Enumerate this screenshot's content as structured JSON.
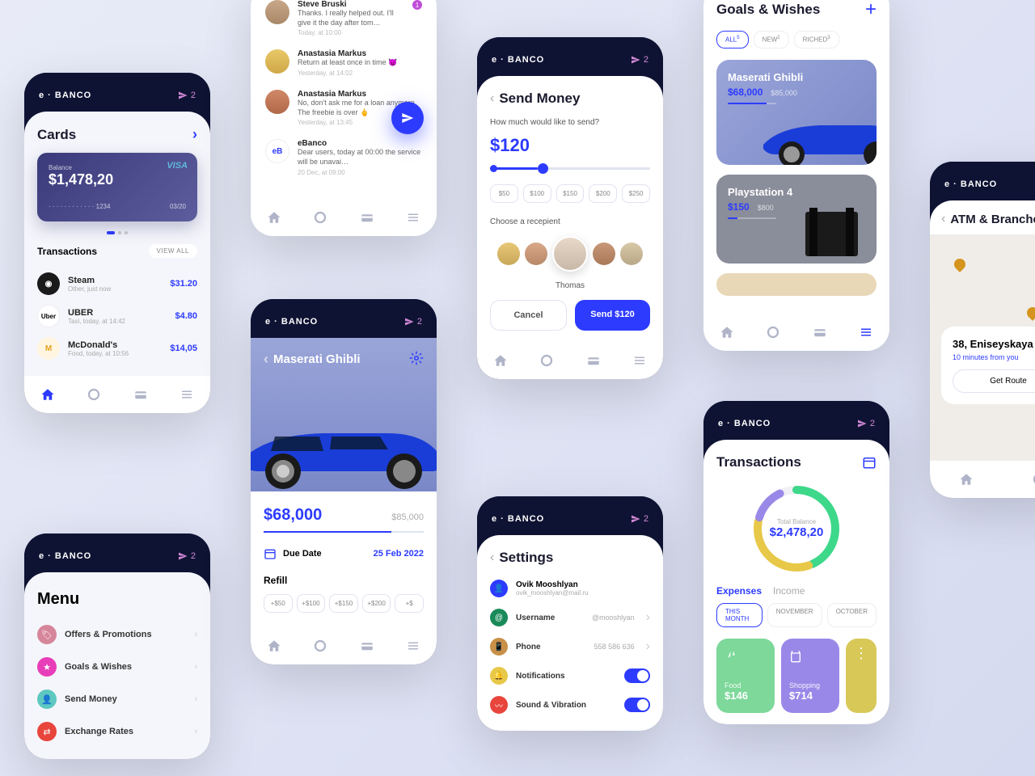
{
  "brand": "e · BANCO",
  "notif_count": "2",
  "home": {
    "cards_title": "Cards",
    "card_network": "VISA",
    "balance_label": "Balance",
    "balance": "$1,478,20",
    "card_last4": "· · · ·   · · · ·   · · · ·   1234",
    "card_exp": "03/20",
    "tx_title": "Transactions",
    "view_all": "VIEW ALL",
    "tx": [
      {
        "name": "Steam",
        "sub": "Other, just now",
        "amt": "$31.20"
      },
      {
        "name": "UBER",
        "sub": "Taxi, today, at 14:42",
        "amt": "$4.80"
      },
      {
        "name": "McDonald's",
        "sub": "Food, today, at 10:56",
        "amt": "$14,05"
      }
    ]
  },
  "menu": {
    "title": "Menu",
    "items": [
      {
        "label": "Offers & Promotions"
      },
      {
        "label": "Goals & Wishes"
      },
      {
        "label": "Send Money"
      },
      {
        "label": "Exchange Rates"
      }
    ]
  },
  "chat": {
    "items": [
      {
        "name": "Steve Bruski",
        "msg": "Thanks. I really helped out. I'll give it the day after tom…",
        "time": "Today, at 10:00",
        "badge": "1"
      },
      {
        "name": "Anastasia Markus",
        "msg": "Return at least once in time 😈",
        "time": "Yesterday, at 14:02"
      },
      {
        "name": "Anastasia Markus",
        "msg": "No, don't ask me for a loan anymore. The freebie is over 🖕",
        "time": "Yesterday, at 13:45"
      },
      {
        "name": "eBanco",
        "msg": "Dear users, today at 00:00 the service will be unavai…",
        "time": "20 Dec, at 09:00",
        "sys": "eB"
      }
    ]
  },
  "goal_detail": {
    "name": "Maserati Ghibli",
    "current": "$68,000",
    "target": "$85,000",
    "due_label": "Due Date",
    "due": "25 Feb 2022",
    "refill_label": "Refill",
    "refill": [
      "+$50",
      "+$100",
      "+$150",
      "+$200",
      "+$"
    ]
  },
  "send": {
    "title": "Send Money",
    "q": "How much would like to send?",
    "amount": "$120",
    "presets": [
      "$50",
      "$100",
      "$150",
      "$200",
      "$250"
    ],
    "choose": "Choose a recepient",
    "selected": "Thomas",
    "cancel": "Cancel",
    "send_btn": "Send $120"
  },
  "settings": {
    "title": "Settings",
    "user_name": "Ovik Mooshlyan",
    "user_email": "ovik_mooshlyan@mail.ru",
    "rows": [
      {
        "label": "Username",
        "val": "@mooshlyan"
      },
      {
        "label": "Phone",
        "val": "558 586 636"
      },
      {
        "label": "Notifications"
      },
      {
        "label": "Sound & Vibration"
      }
    ]
  },
  "goals": {
    "title": "Goals & Wishes",
    "filters": [
      "ALL",
      "NEW",
      "RICHED"
    ],
    "counts": [
      "5",
      "2",
      "3"
    ],
    "g1": {
      "name": "Maserati Ghibli",
      "cur": "$68,000",
      "tgt": "$85,000"
    },
    "g2": {
      "name": "Playstation 4",
      "cur": "$150",
      "tgt": "$800"
    }
  },
  "tx_screen": {
    "title": "Transactions",
    "total_label": "Total Balance",
    "total": "$2,478,20",
    "tabs": [
      "Expenses",
      "Income"
    ],
    "months": [
      "THIS MONTH",
      "NOVEMBER",
      "OCTOBER"
    ],
    "exp": [
      {
        "cat": "Food",
        "amt": "$146"
      },
      {
        "cat": "Shopping",
        "amt": "$714"
      }
    ]
  },
  "atm": {
    "title": "ATM & Branches",
    "addr": "38, Eniseyskaya",
    "time": "10 minutes from you",
    "route": "Get Route"
  }
}
